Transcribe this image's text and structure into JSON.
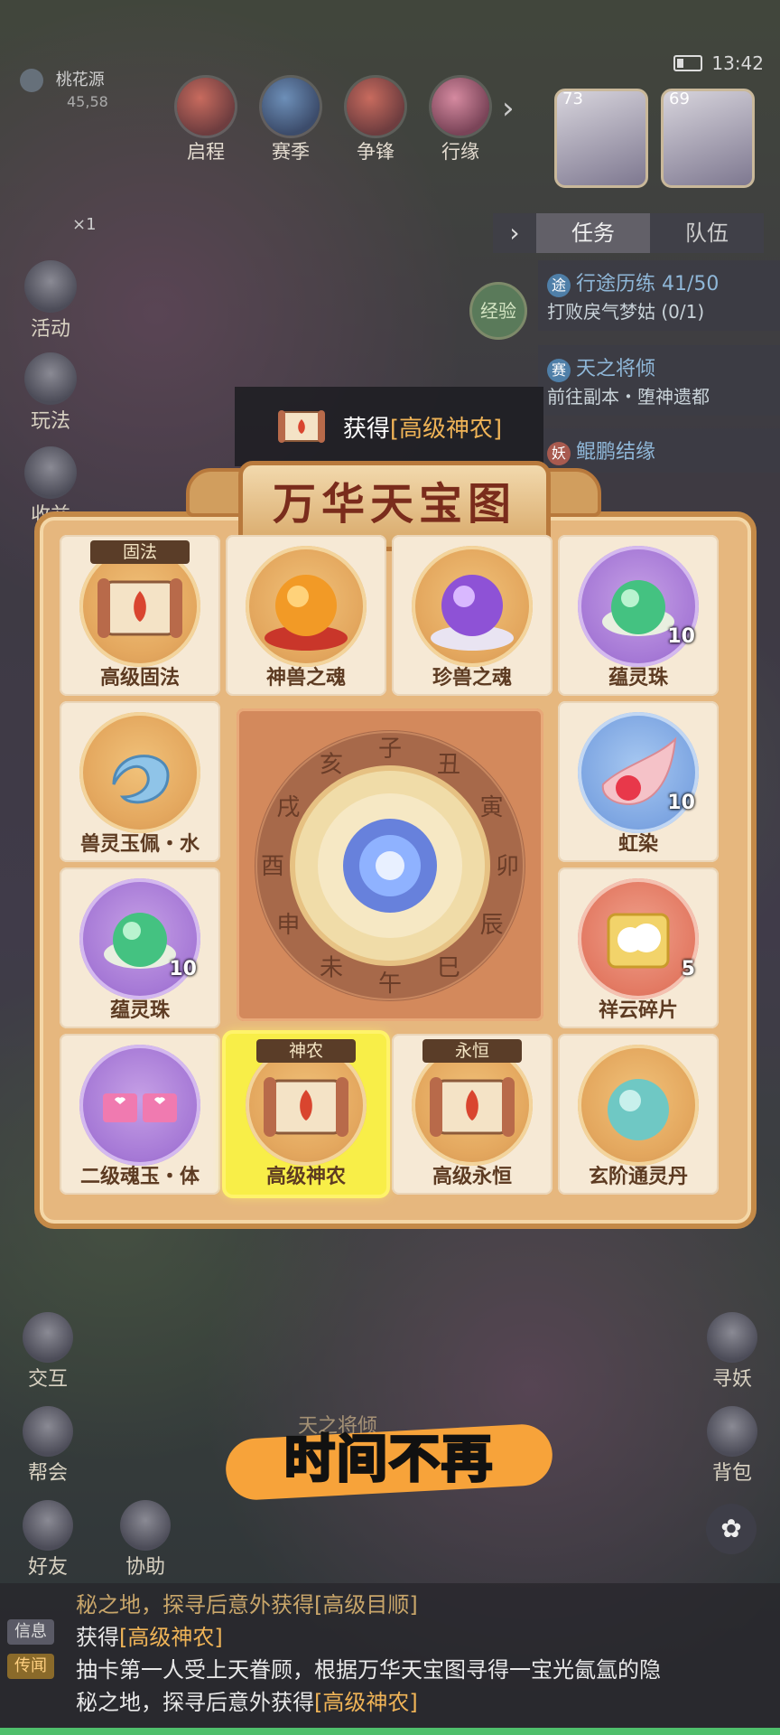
{
  "status": {
    "time": "13:42"
  },
  "location": {
    "name": "桃花源",
    "coords": "45,58",
    "tickets": "×1"
  },
  "topnav": [
    {
      "label": "启程",
      "icon": "journey-icon"
    },
    {
      "label": "赛季",
      "icon": "season-icon"
    },
    {
      "label": "争锋",
      "icon": "battle-icon"
    },
    {
      "label": "行缘",
      "icon": "fate-icon"
    }
  ],
  "avatars": [
    {
      "level": "73"
    },
    {
      "level": "69"
    }
  ],
  "left_buttons": [
    {
      "label": "活动"
    },
    {
      "label": "玩法"
    },
    {
      "label": "收益"
    }
  ],
  "quest": {
    "tabs": [
      "任务",
      "队伍"
    ],
    "exp_label": "经验",
    "items": [
      {
        "tag": "途",
        "title": "行途历练 41/50",
        "desc": "打败戾气梦姑 (0/1)"
      },
      {
        "tag": "赛",
        "title": "天之将倾",
        "desc": "前往副本・堕神遗都"
      },
      {
        "tag": "妖",
        "title": "鲲鹏结缘",
        "desc": ""
      }
    ]
  },
  "notice": {
    "prefix": "获得",
    "item": "[高级神农]"
  },
  "board": {
    "title": "万华天宝图",
    "center": {
      "branches": [
        "子",
        "丑",
        "寅",
        "卯",
        "辰",
        "巳",
        "午",
        "未",
        "申",
        "酉",
        "戌",
        "亥"
      ]
    },
    "cells": [
      {
        "name": "高级固法",
        "ribbon": "固法",
        "disk": "gold",
        "art": "scroll",
        "count": ""
      },
      {
        "name": "神兽之魂",
        "ribbon": "",
        "disk": "gold",
        "art": "orb-orange",
        "count": ""
      },
      {
        "name": "珍兽之魂",
        "ribbon": "",
        "disk": "gold",
        "art": "orb-purple",
        "count": ""
      },
      {
        "name": "蕴灵珠",
        "ribbon": "",
        "disk": "purple",
        "art": "pearl-green",
        "count": "10"
      },
      {
        "name": "兽灵玉佩・水",
        "ribbon": "",
        "disk": "gold",
        "art": "jade-fish",
        "count": ""
      },
      {
        "name": "虹染",
        "ribbon": "",
        "disk": "blue",
        "art": "dye-drop",
        "count": "10"
      },
      {
        "name": "蕴灵珠",
        "ribbon": "",
        "disk": "purple",
        "art": "pearl-green",
        "count": "10"
      },
      {
        "name": "祥云碎片",
        "ribbon": "",
        "disk": "red",
        "art": "cloud-piece",
        "count": "5"
      },
      {
        "name": "二级魂玉・体",
        "ribbon": "",
        "disk": "purple",
        "art": "soul-jade",
        "count": ""
      },
      {
        "name": "高级神农",
        "ribbon": "神农",
        "disk": "gold",
        "art": "scroll",
        "count": "",
        "selected": true
      },
      {
        "name": "高级永恒",
        "ribbon": "永恒",
        "disk": "gold",
        "art": "scroll",
        "count": ""
      },
      {
        "name": "玄阶通灵丹",
        "ribbon": "",
        "disk": "gold",
        "art": "pill-teal",
        "count": ""
      }
    ]
  },
  "bottom_buttons": [
    {
      "label": "交互"
    },
    {
      "label": "帮会"
    },
    {
      "label": "好友"
    },
    {
      "label": "协助"
    },
    {
      "label": "寻妖"
    },
    {
      "label": "背包"
    }
  ],
  "faded_title": "天之将倾",
  "subtitle": "时间不再",
  "chat": {
    "line0": "秘之地，探寻后意外获得[高级目顺]",
    "line1_tag": "信息",
    "line1_prefix": "获得",
    "line1_item": "[高级神农]",
    "line2_tag": "传闻",
    "line2a": "抽卡第一人受上天眷顾，根据万华天宝图寻得一宝光氤氲的隐",
    "line2b_prefix": "秘之地，探寻后意外获得",
    "line2b_item": "[高级神农]"
  },
  "colors": {
    "accent": "#f0b457",
    "board": "#e6b77e",
    "selected": "#f8ee48"
  }
}
